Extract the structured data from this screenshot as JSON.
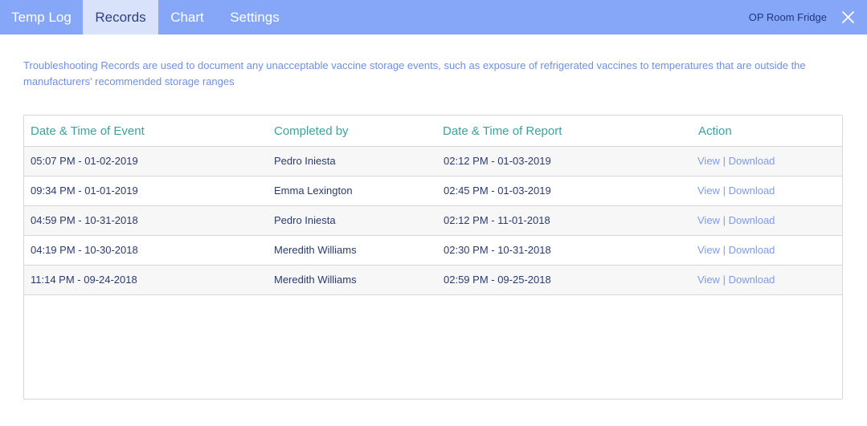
{
  "tabs": [
    {
      "label": "Temp Log",
      "active": false
    },
    {
      "label": "Records",
      "active": true
    },
    {
      "label": "Chart",
      "active": false
    },
    {
      "label": "Settings",
      "active": false
    }
  ],
  "device": {
    "name": "OP Room Fridge"
  },
  "colors": {
    "topbar": "#86a7f8",
    "active_tab": "#d9e2fb",
    "header_text": "#3aa3a0",
    "link": "#7f9be8"
  },
  "description": "Troubleshooting Records are used to document any unacceptable vaccine storage events, such as exposure of refrigerated vaccines to temperatures that are outside the manufacturers' recommended storage ranges",
  "table": {
    "headers": [
      "Date & Time of Event",
      "Completed by",
      "Date & Time of Report",
      "Action"
    ],
    "rows": [
      {
        "event": "05:07 PM - 01-02-2019",
        "by": "Pedro Iniesta",
        "report": "02:12 PM - 01-03-2019"
      },
      {
        "event": "09:34 PM - 01-01-2019",
        "by": "Emma Lexington",
        "report": "02:45 PM - 01-03-2019"
      },
      {
        "event": "04:59 PM - 10-31-2018",
        "by": "Pedro Iniesta",
        "report": "02:12 PM - 11-01-2018"
      },
      {
        "event": "04:19 PM - 10-30-2018",
        "by": "Meredith Williams",
        "report": "02:30 PM - 10-31-2018"
      },
      {
        "event": "11:14 PM - 09-24-2018",
        "by": "Meredith Williams",
        "report": "02:59 PM - 09-25-2018"
      }
    ],
    "action_view": "View",
    "action_separator": "|",
    "action_download": "Download"
  },
  "icons": {
    "close": "close-icon"
  }
}
